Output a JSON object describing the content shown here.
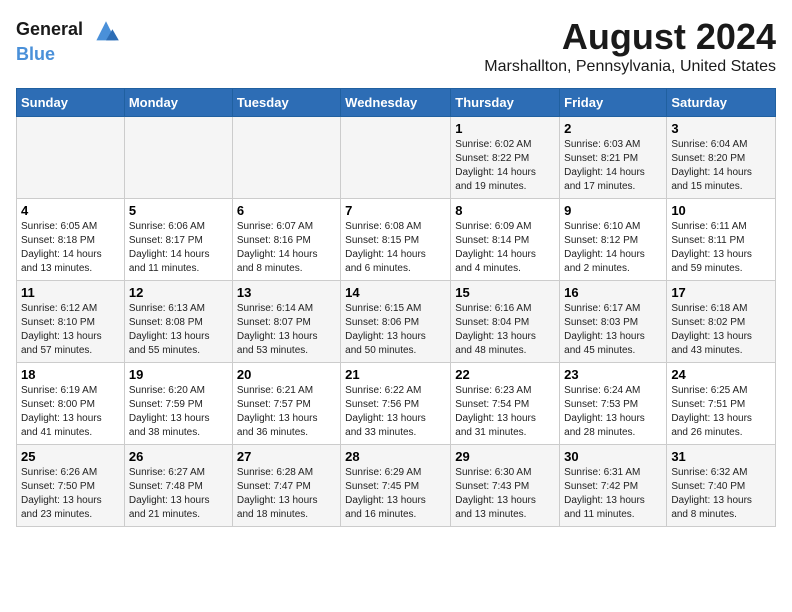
{
  "logo": {
    "line1": "General",
    "line2": "Blue"
  },
  "title": "August 2024",
  "subtitle": "Marshallton, Pennsylvania, United States",
  "days_of_week": [
    "Sunday",
    "Monday",
    "Tuesday",
    "Wednesday",
    "Thursday",
    "Friday",
    "Saturday"
  ],
  "weeks": [
    [
      {
        "day": "",
        "info": ""
      },
      {
        "day": "",
        "info": ""
      },
      {
        "day": "",
        "info": ""
      },
      {
        "day": "",
        "info": ""
      },
      {
        "day": "1",
        "info": "Sunrise: 6:02 AM\nSunset: 8:22 PM\nDaylight: 14 hours\nand 19 minutes."
      },
      {
        "day": "2",
        "info": "Sunrise: 6:03 AM\nSunset: 8:21 PM\nDaylight: 14 hours\nand 17 minutes."
      },
      {
        "day": "3",
        "info": "Sunrise: 6:04 AM\nSunset: 8:20 PM\nDaylight: 14 hours\nand 15 minutes."
      }
    ],
    [
      {
        "day": "4",
        "info": "Sunrise: 6:05 AM\nSunset: 8:18 PM\nDaylight: 14 hours\nand 13 minutes."
      },
      {
        "day": "5",
        "info": "Sunrise: 6:06 AM\nSunset: 8:17 PM\nDaylight: 14 hours\nand 11 minutes."
      },
      {
        "day": "6",
        "info": "Sunrise: 6:07 AM\nSunset: 8:16 PM\nDaylight: 14 hours\nand 8 minutes."
      },
      {
        "day": "7",
        "info": "Sunrise: 6:08 AM\nSunset: 8:15 PM\nDaylight: 14 hours\nand 6 minutes."
      },
      {
        "day": "8",
        "info": "Sunrise: 6:09 AM\nSunset: 8:14 PM\nDaylight: 14 hours\nand 4 minutes."
      },
      {
        "day": "9",
        "info": "Sunrise: 6:10 AM\nSunset: 8:12 PM\nDaylight: 14 hours\nand 2 minutes."
      },
      {
        "day": "10",
        "info": "Sunrise: 6:11 AM\nSunset: 8:11 PM\nDaylight: 13 hours\nand 59 minutes."
      }
    ],
    [
      {
        "day": "11",
        "info": "Sunrise: 6:12 AM\nSunset: 8:10 PM\nDaylight: 13 hours\nand 57 minutes."
      },
      {
        "day": "12",
        "info": "Sunrise: 6:13 AM\nSunset: 8:08 PM\nDaylight: 13 hours\nand 55 minutes."
      },
      {
        "day": "13",
        "info": "Sunrise: 6:14 AM\nSunset: 8:07 PM\nDaylight: 13 hours\nand 53 minutes."
      },
      {
        "day": "14",
        "info": "Sunrise: 6:15 AM\nSunset: 8:06 PM\nDaylight: 13 hours\nand 50 minutes."
      },
      {
        "day": "15",
        "info": "Sunrise: 6:16 AM\nSunset: 8:04 PM\nDaylight: 13 hours\nand 48 minutes."
      },
      {
        "day": "16",
        "info": "Sunrise: 6:17 AM\nSunset: 8:03 PM\nDaylight: 13 hours\nand 45 minutes."
      },
      {
        "day": "17",
        "info": "Sunrise: 6:18 AM\nSunset: 8:02 PM\nDaylight: 13 hours\nand 43 minutes."
      }
    ],
    [
      {
        "day": "18",
        "info": "Sunrise: 6:19 AM\nSunset: 8:00 PM\nDaylight: 13 hours\nand 41 minutes."
      },
      {
        "day": "19",
        "info": "Sunrise: 6:20 AM\nSunset: 7:59 PM\nDaylight: 13 hours\nand 38 minutes."
      },
      {
        "day": "20",
        "info": "Sunrise: 6:21 AM\nSunset: 7:57 PM\nDaylight: 13 hours\nand 36 minutes."
      },
      {
        "day": "21",
        "info": "Sunrise: 6:22 AM\nSunset: 7:56 PM\nDaylight: 13 hours\nand 33 minutes."
      },
      {
        "day": "22",
        "info": "Sunrise: 6:23 AM\nSunset: 7:54 PM\nDaylight: 13 hours\nand 31 minutes."
      },
      {
        "day": "23",
        "info": "Sunrise: 6:24 AM\nSunset: 7:53 PM\nDaylight: 13 hours\nand 28 minutes."
      },
      {
        "day": "24",
        "info": "Sunrise: 6:25 AM\nSunset: 7:51 PM\nDaylight: 13 hours\nand 26 minutes."
      }
    ],
    [
      {
        "day": "25",
        "info": "Sunrise: 6:26 AM\nSunset: 7:50 PM\nDaylight: 13 hours\nand 23 minutes."
      },
      {
        "day": "26",
        "info": "Sunrise: 6:27 AM\nSunset: 7:48 PM\nDaylight: 13 hours\nand 21 minutes."
      },
      {
        "day": "27",
        "info": "Sunrise: 6:28 AM\nSunset: 7:47 PM\nDaylight: 13 hours\nand 18 minutes."
      },
      {
        "day": "28",
        "info": "Sunrise: 6:29 AM\nSunset: 7:45 PM\nDaylight: 13 hours\nand 16 minutes."
      },
      {
        "day": "29",
        "info": "Sunrise: 6:30 AM\nSunset: 7:43 PM\nDaylight: 13 hours\nand 13 minutes."
      },
      {
        "day": "30",
        "info": "Sunrise: 6:31 AM\nSunset: 7:42 PM\nDaylight: 13 hours\nand 11 minutes."
      },
      {
        "day": "31",
        "info": "Sunrise: 6:32 AM\nSunset: 7:40 PM\nDaylight: 13 hours\nand 8 minutes."
      }
    ]
  ]
}
